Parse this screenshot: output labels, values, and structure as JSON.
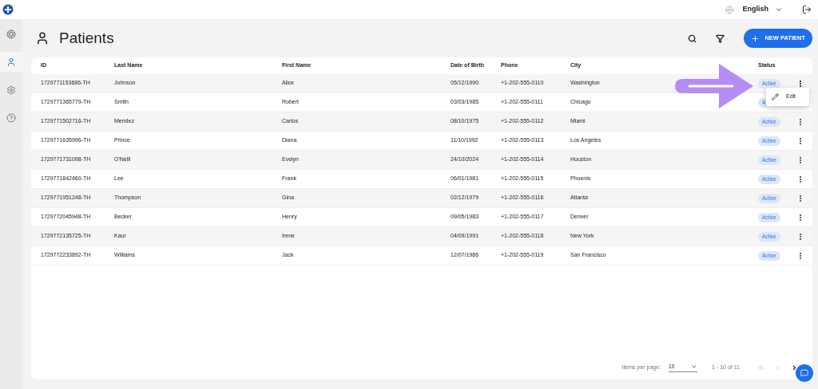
{
  "topbar": {
    "language": "English"
  },
  "sidebar": {
    "items": [
      {
        "kind": "dashboard",
        "selected": false
      },
      {
        "kind": "patients",
        "selected": true
      },
      {
        "kind": "settings",
        "selected": false
      },
      {
        "kind": "help",
        "selected": false
      }
    ]
  },
  "page": {
    "title": "Patients",
    "new_button": "NEW PATIENT"
  },
  "table": {
    "columns": [
      "ID",
      "Last Name",
      "First Name",
      "Date of Birth",
      "Phone",
      "City",
      "Status"
    ],
    "rows": [
      {
        "cells": [
          "1729771153686-TH",
          "Johnson",
          "Alice",
          "05/12/1990",
          "+1-202-555-0110",
          "Washington"
        ],
        "status": "Active",
        "menu_open": true
      },
      {
        "cells": [
          "1729771365779-TH",
          "Smith",
          "Robert",
          "03/03/1985",
          "+1-202-555-0111",
          "Chicago"
        ],
        "status": "A"
      },
      {
        "cells": [
          "1729771502716-TH",
          "Mendez",
          "Carlos",
          "08/10/1975",
          "+1-202-555-0112",
          "Miami"
        ],
        "status": "Active"
      },
      {
        "cells": [
          "1729771635996-TH",
          "Prince",
          "Diana",
          "11/10/1992",
          "+1-202-555-0113",
          "Los Angeles"
        ],
        "status": "Active"
      },
      {
        "cells": [
          "1729771731098-TH",
          "O'Neill",
          "Evelyn",
          "24/10/2024",
          "+1-202-555-0114",
          "Houston"
        ],
        "status": "Active"
      },
      {
        "cells": [
          "1729771842460-TH",
          "Lee",
          "Frank",
          "06/01/1981",
          "+1-202-555-0115",
          "Phoenix"
        ],
        "status": "Active"
      },
      {
        "cells": [
          "1729771951248-TH",
          "Thompson",
          "Gina",
          "02/12/1979",
          "+1-202-555-0116",
          "Atlanta"
        ],
        "status": "Active"
      },
      {
        "cells": [
          "1729772045948-TH",
          "Becker",
          "Henry",
          "09/05/1983",
          "+1-202-555-0117",
          "Denver"
        ],
        "status": "Active"
      },
      {
        "cells": [
          "1729772135725-TH",
          "Kaur",
          "Irene",
          "04/09/1991",
          "+1-202-555-0118",
          "New York"
        ],
        "status": "Active"
      },
      {
        "cells": [
          "1729772233892-TH",
          "Williams",
          "Jack",
          "12/07/1986",
          "+1-202-555-0119",
          "San Francisco"
        ],
        "status": "Active"
      }
    ]
  },
  "row_menu": {
    "items": [
      "Edit"
    ]
  },
  "pagination": {
    "label": "Items per page:",
    "page_size": "10",
    "range": "1 - 10 of 11"
  }
}
